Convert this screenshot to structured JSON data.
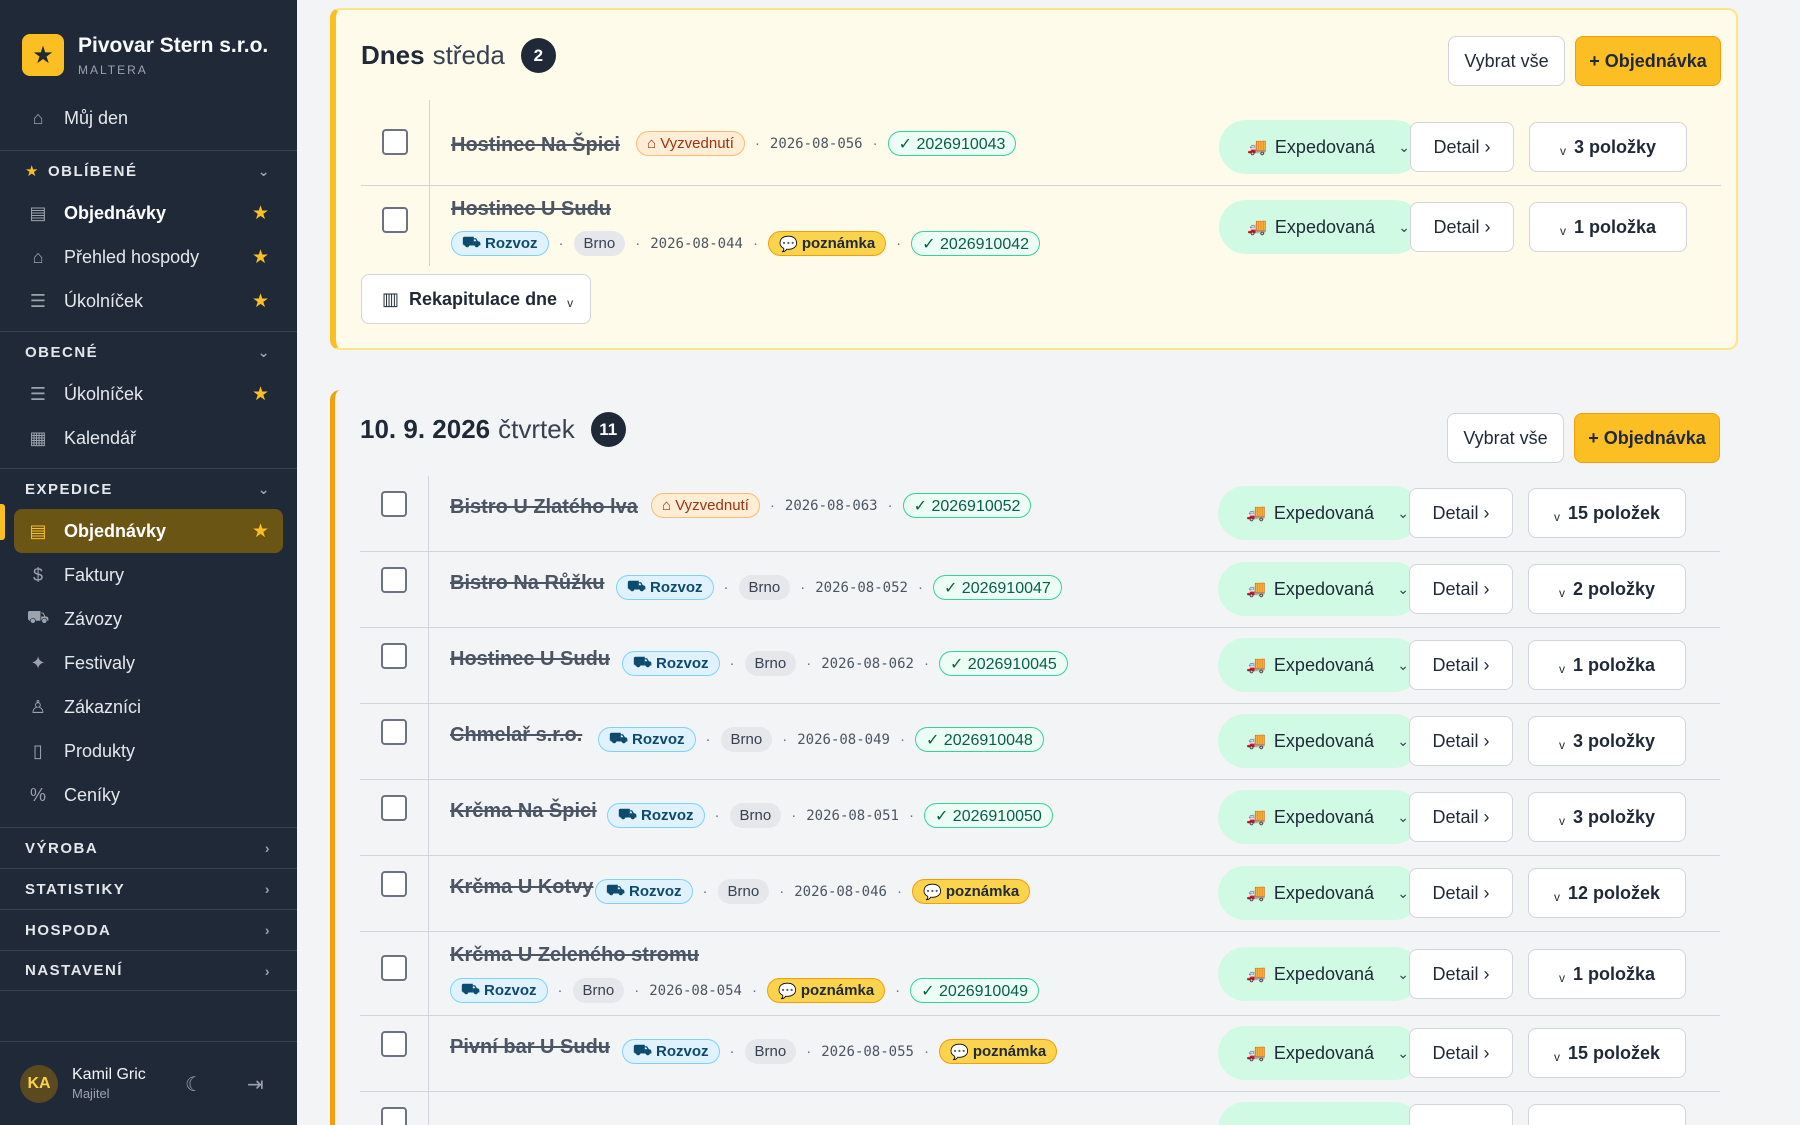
{
  "app": {
    "brand": "Pivovar Stern s.r.o.",
    "sub": "MALTERA"
  },
  "sidebar": {
    "my_day": "Můj den",
    "sections": {
      "fav": "OBLÍBENÉ",
      "general": "OBECNÉ",
      "expedition": "EXPEDICE",
      "production": "VÝROBA",
      "stats": "STATISTIKY",
      "pub": "HOSPODA",
      "settings": "NASTAVENÍ"
    },
    "fav_items": [
      "Objednávky",
      "Přehled hospody",
      "Úkolníček"
    ],
    "general_items": [
      "Úkolníček",
      "Kalendář"
    ],
    "exp_items": [
      "Objednávky",
      "Faktury",
      "Závozy",
      "Festivaly",
      "Zákazníci",
      "Produkty",
      "Ceníky"
    ]
  },
  "user": {
    "initials": "KA",
    "name": "Kamil Gric",
    "role": "Majitel"
  },
  "days": [
    {
      "title": "Dnes",
      "weekday": "středa",
      "count": "2",
      "select_all": "Vybrat vše",
      "new_order": "+ Objednávka",
      "recap": "Rekapitulace dne",
      "orders": [
        {
          "customer": "Hostinec Na Špici",
          "mode": "Vyzvednutí",
          "code": "2026-08-056",
          "invoice": "✓ 2026910043",
          "status": "Expedovaná",
          "items": "3 položky"
        },
        {
          "customer": "Hostinec U Sudu",
          "mode": "Rozvoz",
          "city": "Brno",
          "code": "2026-08-044",
          "note": "poznámka",
          "invoice": "✓ 2026910042",
          "status": "Expedovaná",
          "items": "1 položka"
        }
      ]
    },
    {
      "title": "10. 9. 2026",
      "weekday": "čtvrtek",
      "count": "11",
      "select_all": "Vybrat vše",
      "new_order": "+ Objednávka",
      "orders": [
        {
          "customer": "Bistro U Zlatého lva",
          "mode": "Vyzvednutí",
          "code": "2026-08-063",
          "invoice": "✓ 2026910052",
          "status": "Expedovaná",
          "items": "15 položek"
        },
        {
          "customer": "Bistro Na Růžku",
          "mode": "Rozvoz",
          "city": "Brno",
          "code": "2026-08-052",
          "invoice": "✓ 2026910047",
          "status": "Expedovaná",
          "items": "2 položky"
        },
        {
          "customer": "Hostinec U Sudu",
          "mode": "Rozvoz",
          "city": "Brno",
          "code": "2026-08-062",
          "invoice": "✓ 2026910045",
          "status": "Expedovaná",
          "items": "1 položka"
        },
        {
          "customer": "Chmelař s.r.o.",
          "mode": "Rozvoz",
          "city": "Brno",
          "code": "2026-08-049",
          "invoice": "✓ 2026910048",
          "status": "Expedovaná",
          "items": "3 položky"
        },
        {
          "customer": "Krčma Na Špici",
          "mode": "Rozvoz",
          "city": "Brno",
          "code": "2026-08-051",
          "invoice": "✓ 2026910050",
          "status": "Expedovaná",
          "items": "3 položky"
        },
        {
          "customer": "Krčma U Kotvy",
          "mode": "Rozvoz",
          "city": "Brno",
          "code": "2026-08-046",
          "note": "poznámka",
          "status": "Expedovaná",
          "items": "12 položek"
        },
        {
          "customer": "Krčma U Zeleného stromu",
          "mode": "Rozvoz",
          "city": "Brno",
          "code": "2026-08-054",
          "note": "poznámka",
          "invoice": "✓ 2026910049",
          "status": "Expedovaná",
          "items": "1 položka"
        },
        {
          "customer": "Pivní bar U Sudu",
          "mode": "Rozvoz",
          "city": "Brno",
          "code": "2026-08-055",
          "note": "poznámka",
          "status": "Expedovaná",
          "items": "15 položek"
        }
      ]
    }
  ],
  "labels": {
    "detail": "Detail ›"
  },
  "colors": {
    "accent": "#fbbf24",
    "sidebar": "#1f2937",
    "status_bg": "#d1fae5"
  }
}
